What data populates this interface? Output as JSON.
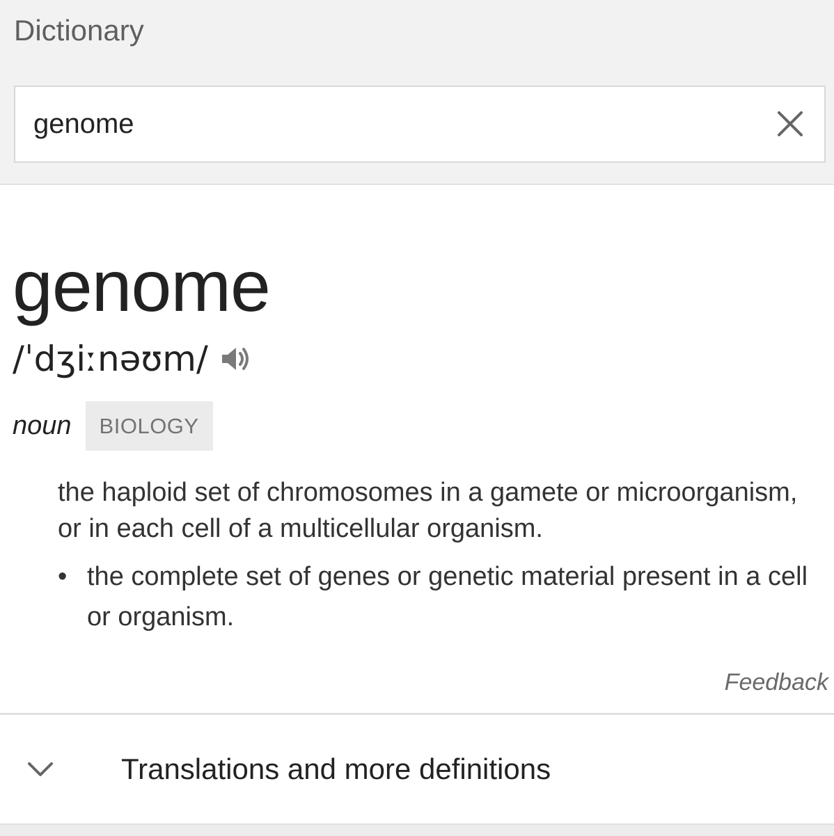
{
  "header": {
    "title": "Dictionary"
  },
  "search": {
    "value": "genome",
    "clear_icon": "close-icon"
  },
  "entry": {
    "word": "genome",
    "pronunciation": "/ˈdʒiːnəʊm/",
    "audio_icon": "speaker-icon",
    "part_of_speech": "noun",
    "domain_label": "BIOLOGY",
    "definition": "the haploid set of chromosomes in a gamete or microorganism, or in each cell of a multicellular organism.",
    "sub_definitions": [
      "the complete set of genes or genetic material present in a cell or organism."
    ]
  },
  "feedback_label": "Feedback",
  "more": {
    "label": "Translations and more definitions",
    "icon": "chevron-down-icon"
  },
  "colors": {
    "header_bg": "#f2f2f2",
    "badge_bg": "#ebebeb",
    "badge_text": "#737373",
    "muted_text": "#5f5f5f"
  }
}
